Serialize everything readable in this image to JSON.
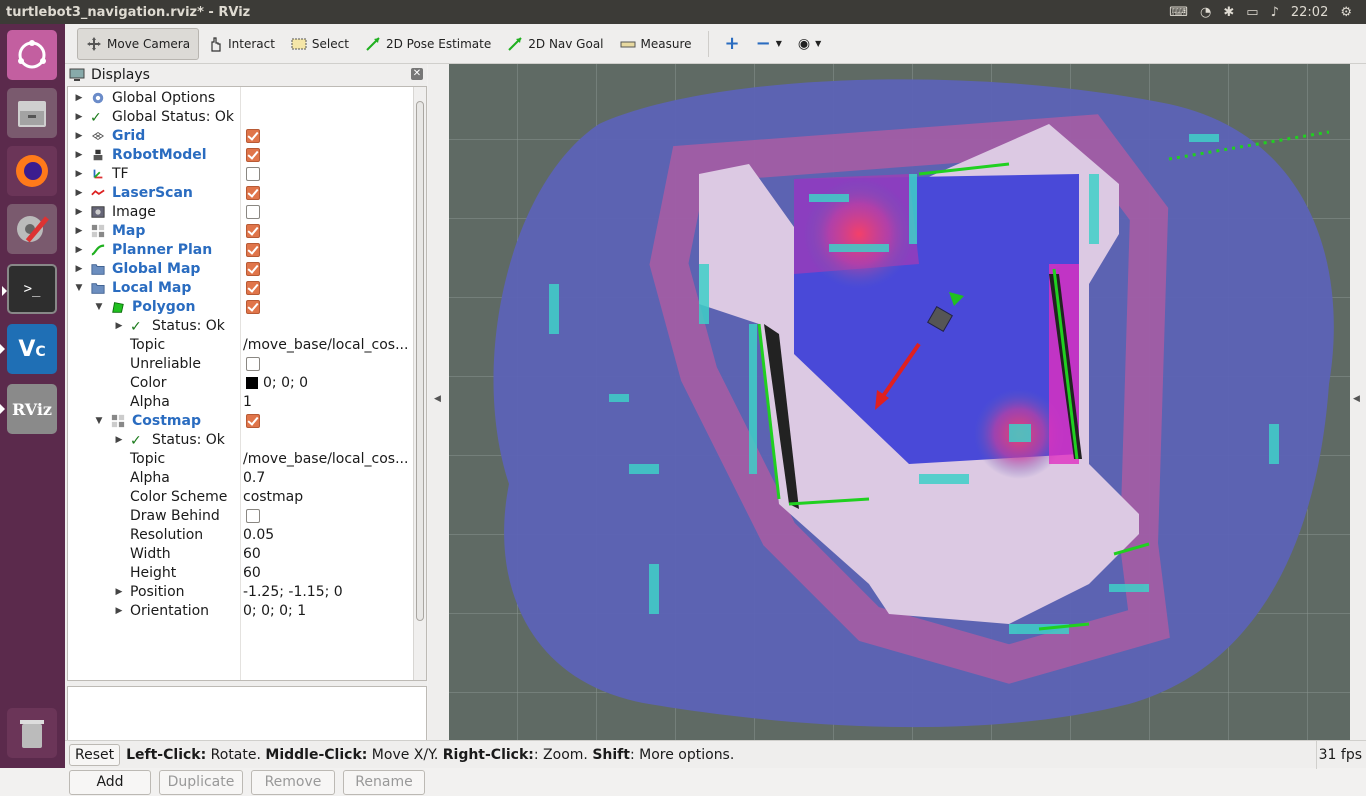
{
  "window": {
    "title": "turtlebot3_navigation.rviz* - RViz",
    "clock": "22:02"
  },
  "toolbar": {
    "move_camera": "Move Camera",
    "interact": "Interact",
    "select": "Select",
    "pose_estimate": "2D Pose Estimate",
    "nav_goal": "2D Nav Goal",
    "measure": "Measure"
  },
  "panel": {
    "title": "Displays",
    "buttons": {
      "add": "Add",
      "duplicate": "Duplicate",
      "remove": "Remove",
      "rename": "Rename"
    }
  },
  "tree": {
    "global_options": "Global Options",
    "global_status": "Global Status: Ok",
    "grid": "Grid",
    "robot_model": "RobotModel",
    "tf": "TF",
    "laser_scan": "LaserScan",
    "image": "Image",
    "map": "Map",
    "planner_plan": "Planner Plan",
    "global_map": "Global Map",
    "local_map": "Local Map",
    "polygon": {
      "label": "Polygon",
      "status": "Status: Ok",
      "topic_label": "Topic",
      "topic_value": "/move_base/local_cos...",
      "unreliable_label": "Unreliable",
      "color_label": "Color",
      "color_value": "0; 0; 0",
      "alpha_label": "Alpha",
      "alpha_value": "1"
    },
    "costmap": {
      "label": "Costmap",
      "status": "Status: Ok",
      "topic_label": "Topic",
      "topic_value": "/move_base/local_cos...",
      "alpha_label": "Alpha",
      "alpha_value": "0.7",
      "scheme_label": "Color Scheme",
      "scheme_value": "costmap",
      "draw_behind_label": "Draw Behind",
      "resolution_label": "Resolution",
      "resolution_value": "0.05",
      "width_label": "Width",
      "width_value": "60",
      "height_label": "Height",
      "height_value": "60",
      "position_label": "Position",
      "position_value": "-1.25; -1.15; 0",
      "orientation_label": "Orientation",
      "orientation_value": "0; 0; 0; 1"
    }
  },
  "statusbar": {
    "reset": "Reset",
    "hint_left_key": "Left-Click:",
    "hint_left": " Rotate. ",
    "hint_middle_key": "Middle-Click:",
    "hint_middle": " Move X/Y. ",
    "hint_right_key": "Right-Click:",
    "hint_right": ": Zoom. ",
    "hint_shift_key": "Shift",
    "hint_shift": ": More options.",
    "fps": "31 fps"
  },
  "colors": {
    "launcher": "#5b2a4c",
    "view_bg": "#5f6a64",
    "accent_check": "#e0754a",
    "display_blue": "#2a6cc0",
    "costmap_blue": "#4040e0",
    "costmap_magenta": "#e030c0",
    "path_green": "#20d020"
  }
}
